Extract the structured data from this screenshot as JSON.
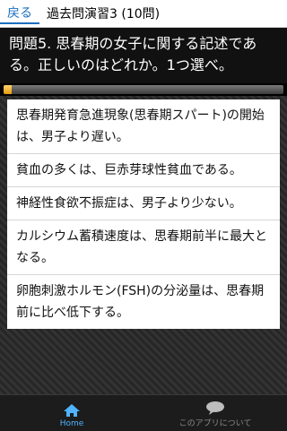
{
  "header": {
    "back_label": "戻る",
    "title": "過去問演習3 (10問)"
  },
  "question": {
    "text": "問題5. 思春期の女子に関する記述である。正しいのはどれか。1つ選べ。"
  },
  "progress": {
    "fraction": 0.03,
    "colors": {
      "fill": "#e49a12",
      "track": "#5a5a5a"
    }
  },
  "answers": [
    {
      "text": "思春期発育急進現象(思春期スパート)の開始は、男子より遅い。"
    },
    {
      "text": "貧血の多くは、巨赤芽球性貧血である。"
    },
    {
      "text": "神経性食欲不振症は、男子より少ない。"
    },
    {
      "text": "カルシウム蓄積速度は、思春期前半に最大となる。"
    },
    {
      "text": "卵胞刺激ホルモン(FSH)の分泌量は、思春期前に比べ低下する。"
    }
  ],
  "bottom_nav": {
    "home": {
      "label": "Home",
      "icon": "home-icon"
    },
    "about": {
      "label": "このアプリについて",
      "icon": "speech-bubble-icon"
    }
  }
}
